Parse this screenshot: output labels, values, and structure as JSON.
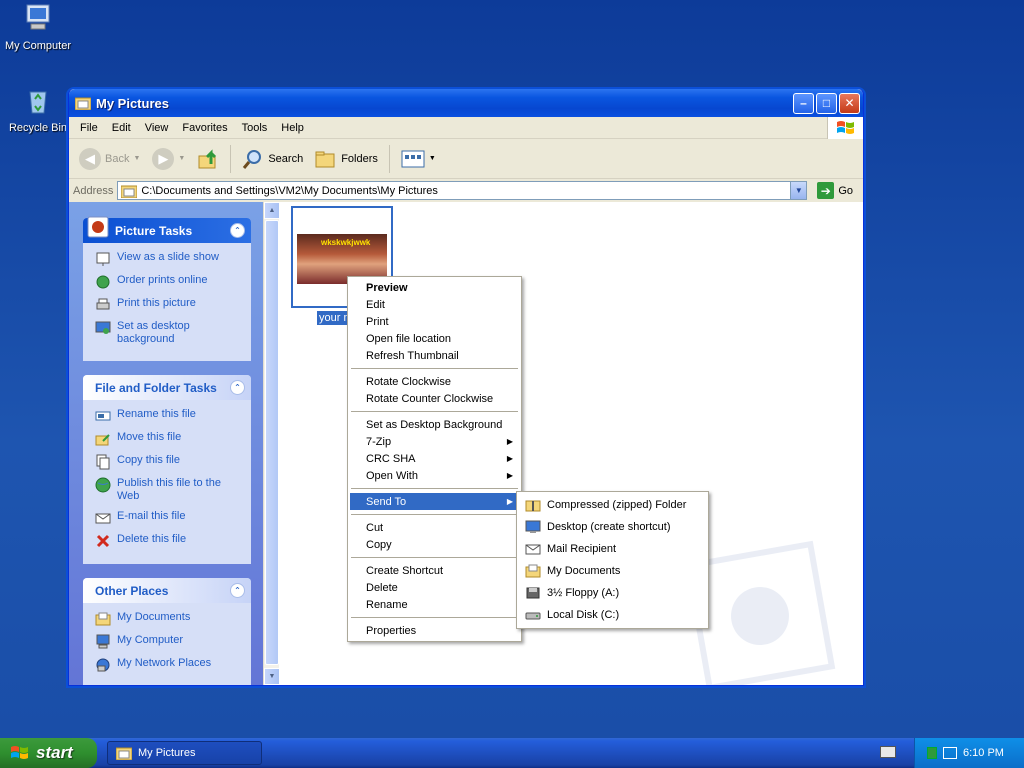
{
  "desktop": {
    "icons": [
      {
        "label": "My Computer"
      },
      {
        "label": "Recycle Bin"
      }
    ]
  },
  "window": {
    "title": "My Pictures",
    "menu": [
      "File",
      "Edit",
      "View",
      "Favorites",
      "Tools",
      "Help"
    ],
    "toolbar": {
      "back": "Back",
      "search": "Search",
      "folders": "Folders"
    },
    "address": {
      "label": "Address",
      "path": "C:\\Documents and Settings\\VM2\\My Documents\\My Pictures",
      "go": "Go"
    }
  },
  "sidebar": {
    "picture_tasks": {
      "title": "Picture Tasks",
      "items": [
        "View as a slide show",
        "Order prints online",
        "Print this picture",
        "Set as desktop background"
      ]
    },
    "file_folder_tasks": {
      "title": "File and Folder Tasks",
      "items": [
        "Rename this file",
        "Move this file",
        "Copy this file",
        "Publish this file to the Web",
        "E-mail this file",
        "Delete this file"
      ]
    },
    "other_places": {
      "title": "Other Places",
      "items": [
        "My Documents",
        "My Computer",
        "My Network Places"
      ]
    }
  },
  "file": {
    "label": "your m",
    "caption": "wkskwkjwwk"
  },
  "context_menu": {
    "group1": [
      "Preview",
      "Edit",
      "Print",
      "Open file location",
      "Refresh Thumbnail"
    ],
    "group2": [
      "Rotate Clockwise",
      "Rotate Counter Clockwise"
    ],
    "group3": [
      "Set as Desktop Background",
      "7-Zip",
      "CRC SHA",
      "Open With"
    ],
    "group4": [
      "Send To"
    ],
    "group5": [
      "Cut",
      "Copy"
    ],
    "group6": [
      "Create Shortcut",
      "Delete",
      "Rename"
    ],
    "group7": [
      "Properties"
    ]
  },
  "send_to_menu": [
    "Compressed (zipped) Folder",
    "Desktop (create shortcut)",
    "Mail Recipient",
    "My Documents",
    "3½ Floppy (A:)",
    "Local Disk (C:)"
  ],
  "taskbar": {
    "start": "start",
    "task": "My Pictures",
    "clock": "6:10 PM"
  }
}
